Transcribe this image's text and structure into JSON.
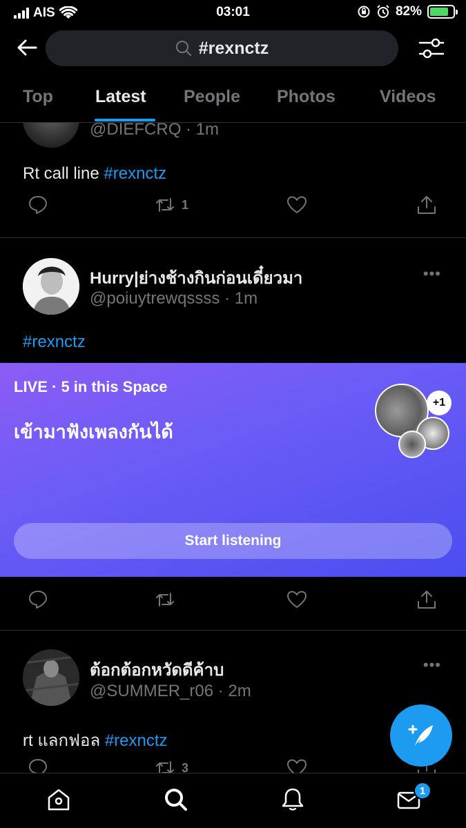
{
  "status_bar": {
    "carrier": "AIS",
    "time": "03:01",
    "battery_percent": "82%",
    "battery_level": 0.82
  },
  "search": {
    "query": "#rexnctz"
  },
  "tabs": [
    {
      "label": "Top",
      "active": false
    },
    {
      "label": "Latest",
      "active": true
    },
    {
      "label": "People",
      "active": false
    },
    {
      "label": "Photos",
      "active": false
    },
    {
      "label": "Videos",
      "active": false
    }
  ],
  "tweets": [
    {
      "handle": "@DIEFCRQ · 1m",
      "text_prefix": "Rt call line ",
      "hashtag": "#rexnctz",
      "retweets": "1",
      "replies": "",
      "likes": ""
    },
    {
      "name": "Hurry|ย่างช้างกินก่อนเดี๋ยวมา",
      "handle": "@poiuytrewqssss · 1m",
      "hashtag": "#rexnctz",
      "more": "•••"
    },
    {
      "name": "ต้อกต้อกหวัดดีค้าบ",
      "handle": "@SUMMER_r06 · 2m",
      "text_prefix": "rt แลกฟอล ",
      "hashtag": "#rexnctz",
      "retweets": "3",
      "more": "•••"
    }
  ],
  "space": {
    "live_label": "LIVE · 5 in this Space",
    "title": "เข้ามาฟังเพลงกันได้",
    "button_label": "Start listening",
    "extra_count": "+1"
  },
  "bottom_nav": {
    "items": [
      "home-icon",
      "search-icon",
      "notifications-icon",
      "messages-icon"
    ],
    "messages_badge": "1"
  },
  "colors": {
    "accent": "#1d9bf0",
    "background": "#000000",
    "muted_text": "#71767b",
    "space_gradient_start": "#8c5cf5",
    "space_gradient_end": "#4b4df0"
  }
}
